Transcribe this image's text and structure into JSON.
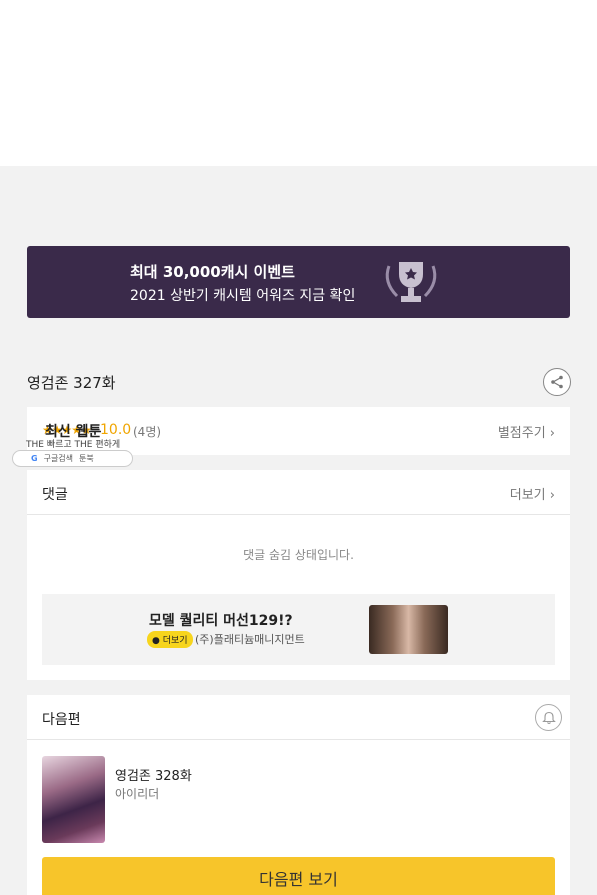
{
  "banner": {
    "line1": "최대 30,000캐시 이벤트",
    "line2": "2021 상반기 캐시템 어워즈 지금 확인",
    "icon": "trophy-icon"
  },
  "episode": {
    "title": "영검존 327화",
    "share_icon": "share-icon"
  },
  "rating": {
    "category": "최신 웹툰",
    "stars": "★★★★★",
    "score": "10.0",
    "count": "(4명)",
    "rate_link": "별점주기",
    "chevron": "›"
  },
  "overlay_ad": {
    "tagline": "THE 빠르고 THE 편하게",
    "google": "G",
    "search_label": "구글검색",
    "app_label": "툰북"
  },
  "comments": {
    "label": "댓글",
    "more": "더보기",
    "chevron": "›",
    "hidden_message": "댓글 숨김 상태입니다."
  },
  "ad": {
    "title": "모델 퀄리티 머선129!?",
    "chip": "더보기",
    "company": "(주)플래티늄매니지먼트"
  },
  "next": {
    "label": "다음편",
    "bell_icon": "bell-icon",
    "episode": "영검존 328화",
    "author": "아이리더",
    "button": "다음편 보기"
  },
  "colors": {
    "banner_bg": "#3a2a4a",
    "accent_yellow": "#f7c52a",
    "star": "#f0a500"
  }
}
